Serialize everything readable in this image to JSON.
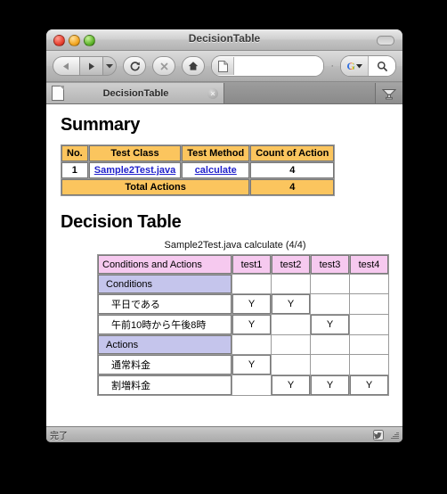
{
  "window": {
    "title": "DecisionTable",
    "traffic_lights": [
      "close-button",
      "minimize-button",
      "zoom-button"
    ]
  },
  "toolbar": {
    "back_icon": "back-arrow-icon",
    "forward_icon": "forward-arrow-icon",
    "history_dropdown_icon": "chevron-down-icon",
    "reload_icon": "reload-icon",
    "stop_icon": "stop-icon",
    "home_icon": "home-icon",
    "address_value": "",
    "address_placeholder": "",
    "address_go_icon": "go-arrow-icon",
    "address_dropdown_icon": "chevron-down-icon",
    "separator": "·",
    "search_engine_label": "G",
    "search_value": "",
    "search_placeholder": "",
    "search_icon": "search-icon"
  },
  "tabbar": {
    "tab_label": "DecisionTable",
    "tab_close_glyph": "×",
    "tab_doc_icon": "document-icon",
    "cart_icon": "cart-icon"
  },
  "summary": {
    "heading": "Summary",
    "columns": [
      "No.",
      "Test Class",
      "Test Method",
      "Count of Action"
    ],
    "rows": [
      {
        "no": "1",
        "test_class": "Sample2Test.java",
        "test_method": "calculate",
        "count": "4"
      }
    ],
    "total_label": "Total Actions",
    "total_value": "4"
  },
  "decision": {
    "heading": "Decision Table",
    "caption": "Sample2Test.java calculate (4/4)",
    "header_label": "Conditions and Actions",
    "test_columns": [
      "test1",
      "test2",
      "test3",
      "test4"
    ],
    "groups": [
      {
        "name": "Conditions",
        "rows": [
          {
            "label": "平日である",
            "marks": [
              "Y",
              "Y",
              "",
              ""
            ]
          },
          {
            "label": "午前10時から午後8時",
            "marks": [
              "Y",
              "",
              "Y",
              ""
            ]
          }
        ]
      },
      {
        "name": "Actions",
        "rows": [
          {
            "label": "通常料金",
            "marks": [
              "Y",
              "",
              "",
              ""
            ]
          },
          {
            "label": "割増料金",
            "marks": [
              "",
              "Y",
              "Y",
              "Y"
            ]
          }
        ]
      }
    ]
  },
  "statusbar": {
    "text": "完了",
    "twitter_icon": "twitter-bird-icon",
    "resize_icon": "resize-grip-icon"
  },
  "colors": {
    "summary_header": "#fbc55e",
    "decision_header": "#f6c9ef",
    "decision_group": "#c5c5ec",
    "link": "#2222cc"
  }
}
